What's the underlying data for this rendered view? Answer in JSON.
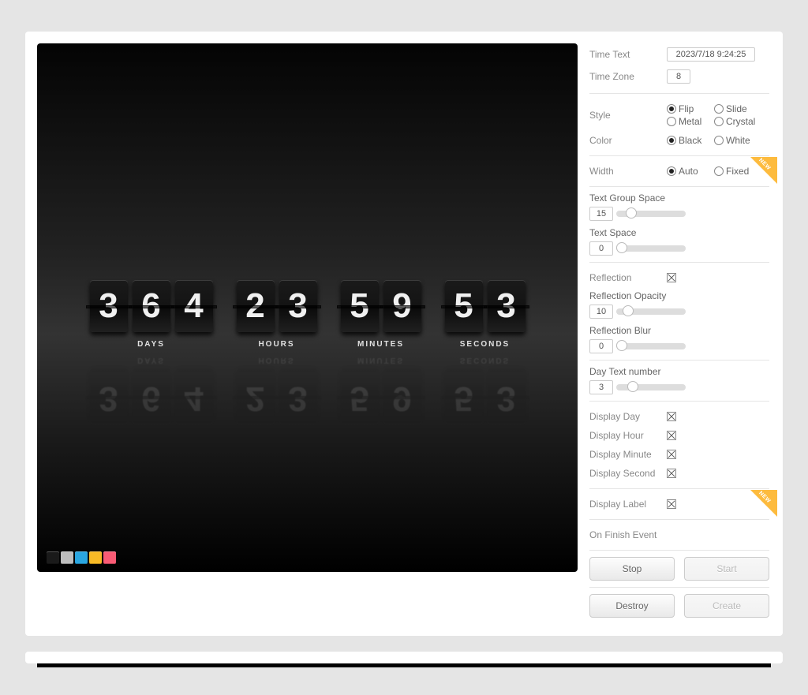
{
  "clock": {
    "days": [
      "3",
      "6",
      "4"
    ],
    "hours": [
      "2",
      "3"
    ],
    "minutes": [
      "5",
      "9"
    ],
    "seconds": [
      "5",
      "3"
    ],
    "labels": {
      "days": "DAYS",
      "hours": "HOURS",
      "minutes": "MINUTES",
      "seconds": "SECONDS"
    }
  },
  "swatches": [
    "#1a1a1a",
    "#bdbdbd",
    "#2aa6e0",
    "#f7ba26",
    "#f95b75"
  ],
  "form": {
    "timeText": {
      "label": "Time Text",
      "value": "2023/7/18 9:24:25"
    },
    "timeZone": {
      "label": "Time Zone",
      "value": "8"
    },
    "style": {
      "label": "Style",
      "options": [
        {
          "label": "Flip",
          "checked": true
        },
        {
          "label": "Slide",
          "checked": false
        },
        {
          "label": "Metal",
          "checked": false
        },
        {
          "label": "Crystal",
          "checked": false
        }
      ]
    },
    "color": {
      "label": "Color",
      "options": [
        {
          "label": "Black",
          "checked": true
        },
        {
          "label": "White",
          "checked": false
        }
      ]
    },
    "width": {
      "label": "Width",
      "options": [
        {
          "label": "Auto",
          "checked": true
        },
        {
          "label": "Fixed",
          "checked": false
        }
      ]
    },
    "textGroupSpace": {
      "label": "Text Group Space",
      "value": "15",
      "knob": 12
    },
    "textSpace": {
      "label": "Text Space",
      "value": "0",
      "knob": 0
    },
    "reflection": {
      "label": "Reflection",
      "checked": true
    },
    "reflectionOpacity": {
      "label": "Reflection Opacity",
      "value": "10",
      "knob": 8
    },
    "reflectionBlur": {
      "label": "Reflection Blur",
      "value": "0",
      "knob": 0
    },
    "dayTextNumber": {
      "label": "Day Text number",
      "value": "3",
      "knob": 14
    },
    "displayDay": {
      "label": "Display Day",
      "checked": true
    },
    "displayHour": {
      "label": "Display Hour",
      "checked": true
    },
    "displayMinute": {
      "label": "Display Minute",
      "checked": true
    },
    "displaySecond": {
      "label": "Display Second",
      "checked": true
    },
    "displayLabel": {
      "label": "Display Label",
      "checked": true
    },
    "onFinish": {
      "label": "On Finish Event"
    },
    "buttons": {
      "stop": "Stop",
      "start": "Start",
      "destroy": "Destroy",
      "create": "Create"
    }
  }
}
